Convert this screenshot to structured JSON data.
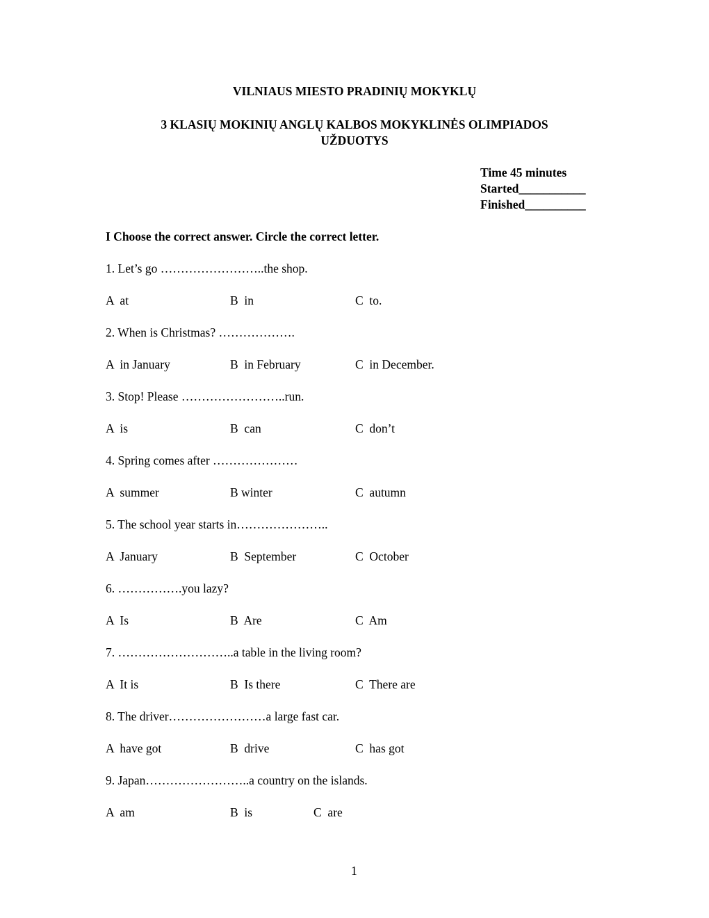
{
  "header": {
    "title_line1": "VILNIAUS MIESTO PRADINIŲ MOKYKLŲ",
    "title_line2": "3 KLASIŲ MOKINIŲ ANGLŲ KALBOS MOKYKLINĖS OLIMPIADOS",
    "title_line3": "UŽDUOTYS"
  },
  "meta": {
    "time": "Time 45 minutes",
    "started": "Started___________",
    "finished": "Finished__________"
  },
  "section": {
    "instruction": "I  Choose the correct answer. Circle the correct letter."
  },
  "questions": [
    {
      "text": "1. Let’s go ……………………..the shop.",
      "options": [
        "A  at",
        "B  in",
        "C  to."
      ]
    },
    {
      "text": "2. When is Christmas? ……………….",
      "options": [
        "A  in January",
        "B  in February",
        "C  in December."
      ]
    },
    {
      "text": "3. Stop! Please ……………………..run.",
      "options": [
        "A  is",
        "B  can",
        "C  don’t"
      ]
    },
    {
      "text": "4. Spring comes after …………………",
      "options": [
        "A  summer",
        "B winter",
        "C  autumn"
      ]
    },
    {
      "text": "5. The school year starts in…………………..",
      "options": [
        "A  January",
        "B  September",
        "C  October"
      ]
    },
    {
      "text": "6. …………….you lazy?",
      "options": [
        "A  Is",
        "B  Are",
        "C  Am"
      ]
    },
    {
      "text": "7. ………………………..a table in the living room?",
      "options": [
        "A  It is",
        "B  Is there",
        "C  There are"
      ]
    },
    {
      "text": "8. The driver……………………a large fast car.",
      "options": [
        "A  have got",
        "B  drive",
        "C  has got"
      ]
    },
    {
      "text": "9. Japan……………………..a country on the islands.",
      "options": [
        "A  am",
        "B  is",
        "C  are"
      ]
    }
  ],
  "footer": {
    "page_number": "1"
  }
}
